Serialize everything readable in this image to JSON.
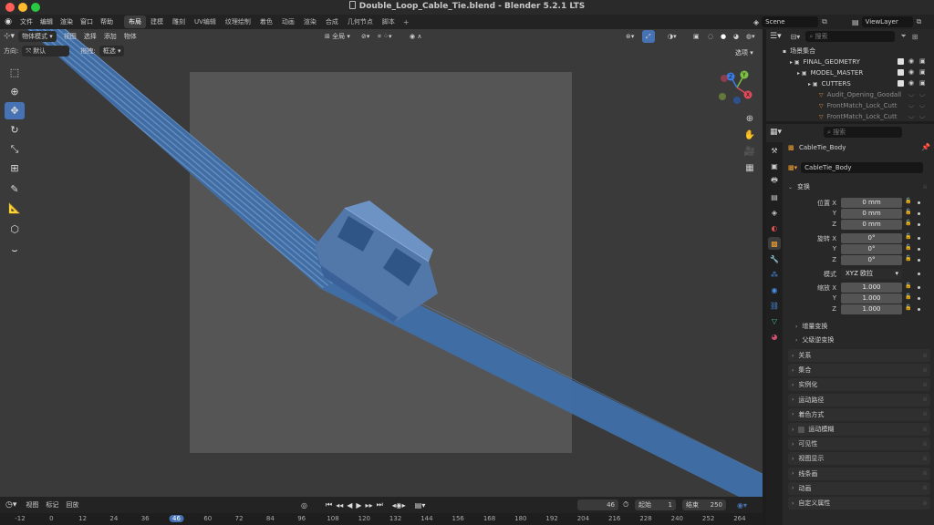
{
  "window": {
    "title": "Double_Loop_Cable_Tie.blend - Blender 5.2.1 LTS",
    "traffic_colors": [
      "#fe5f57",
      "#febc2e",
      "#28c840"
    ]
  },
  "topbar": {
    "menus": [
      "文件",
      "编辑",
      "渲染",
      "窗口",
      "帮助"
    ],
    "workspaces": [
      "布局",
      "建模",
      "雕刻",
      "UV编辑",
      "纹理绘制",
      "着色",
      "动画",
      "渲染",
      "合成",
      "几何节点",
      "脚本"
    ],
    "active_workspace": "布局",
    "add_tab": "+",
    "scene": "Scene",
    "view_layer": "ViewLayer"
  },
  "viewport": {
    "mode": "物体模式",
    "menus": [
      "视图",
      "选择",
      "添加",
      "物体"
    ],
    "orientation_label": "方向:",
    "orientation_value": "默认",
    "drag_label": "拖拽:",
    "drag_value": "框选",
    "transform_pivot": "全局",
    "options": "选项",
    "gizmo_axes": [
      "X",
      "Y",
      "Z"
    ],
    "accent": "#4772b3",
    "object_color": "#3f6fa8"
  },
  "timeline": {
    "menus": [
      "视图",
      "标记",
      "回放"
    ],
    "current_frame": "46",
    "start_label": "起始",
    "start_value": "1",
    "end_label": "结束",
    "end_value": "250",
    "ticks": [
      "-12",
      "0",
      "12",
      "24",
      "36",
      "46",
      "60",
      "72",
      "84",
      "96",
      "108",
      "120",
      "132",
      "144",
      "156",
      "168",
      "180",
      "192",
      "204",
      "216",
      "228",
      "240",
      "252",
      "264"
    ]
  },
  "outliner": {
    "search_placeholder": "搜索",
    "rows": [
      {
        "label": "场景集合",
        "icon": "collection"
      },
      {
        "label": "FINAL_GEOMETRY",
        "icon": "collection"
      },
      {
        "label": "MODEL_MASTER",
        "icon": "collection"
      },
      {
        "label": "CUTTERS",
        "icon": "collection"
      },
      {
        "label": "Audit_Opening_Goodall",
        "icon": "mesh",
        "dim": true
      },
      {
        "label": "FrontMatch_Lock_Cutt",
        "icon": "mesh",
        "dim": true
      },
      {
        "label": "FrontMatch_Lock_Cutt",
        "icon": "mesh",
        "dim": true
      }
    ]
  },
  "properties": {
    "search_placeholder": "搜索",
    "object_name": "CableTie_Body",
    "object_field": "CableTie_Body",
    "transform_header": "变换",
    "location_label": "位置 X",
    "location": [
      "0 mm",
      "0 mm",
      "0 mm"
    ],
    "rotation_label": "旋转 X",
    "rotation": [
      "0°",
      "0°",
      "0°"
    ],
    "mode_label": "模式",
    "mode_value": "XYZ 欧拉",
    "scale_label": "缩放 X",
    "scale": [
      "1.000",
      "1.000",
      "1.000"
    ],
    "axis_y": "Y",
    "axis_z": "Z",
    "delta_transform": "增量变换",
    "parent_inverse": "父级逆变换",
    "sections": [
      "关系",
      "集合",
      "实例化",
      "运动路径",
      "着色方式",
      "运动模糊",
      "可见性",
      "视图显示",
      "线条画",
      "动画",
      "自定义属性"
    ]
  }
}
